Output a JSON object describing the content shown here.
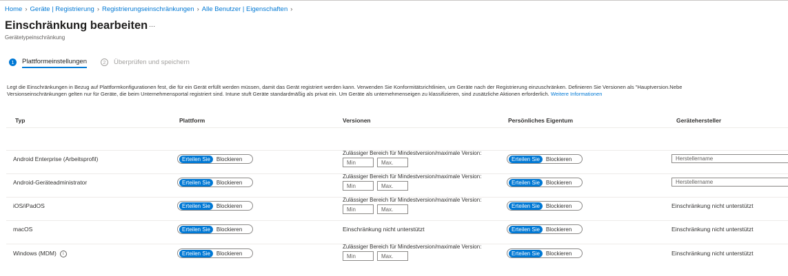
{
  "breadcrumb": [
    "Home",
    "Geräte | Registrierung",
    "Registrierungseinschränkungen",
    "Alle Benutzer | Eigenschaften"
  ],
  "header": {
    "title": "Einschränkung bearbeiten",
    "more": "...",
    "subtitle": "Gerätetypeinschränkung"
  },
  "steps": [
    {
      "num": "1",
      "label": "Plattformeinstellungen"
    },
    {
      "num": "2",
      "label": "Überprüfen und speichern"
    }
  ],
  "description": {
    "line1": "Legt die Einschränkungen in Bezug auf Plattformkonfigurationen fest, die für ein Gerät erfüllt werden müssen, damit das Gerät registriert werden kann. Verwenden Sie Konformitätsrichtlinien, um Geräte nach der Registrierung einzuschränken. Definieren Sie Versionen als \"Hauptversion.Nebe",
    "line2": "Versionseinschränkungen gelten nur für Geräte, die beim Unternehmensportal registriert sind. Intune stuft Geräte standardmäßig als privat ein. Um Geräte als unternehmenseigen zu klassifizieren, sind zusätzliche Aktionen erforderlich.",
    "link": "Weitere Informationen"
  },
  "table": {
    "headers": {
      "type": "Typ",
      "platform": "Plattform",
      "versions": "Versionen",
      "ownership": "Persönliches Eigentum",
      "manufacturer": "Gerätehersteller"
    },
    "toggle": {
      "allow": "Erteilen Sie",
      "block": "Blockieren"
    },
    "version_label": "Zulässiger Bereich für Mindestversion/maximale Version:",
    "min_placeholder": "Min",
    "max_placeholder": "Max.",
    "manufacturer_placeholder": "Herstellername",
    "not_supported": "Einschränkung nicht unterstützt",
    "rows": [
      {
        "type": "Android Enterprise (Arbeitsprofil)"
      },
      {
        "type": "Android-Geräteadministrator"
      },
      {
        "type": "iOS/iPadOS"
      },
      {
        "type": "macOS"
      },
      {
        "type": "Windows (MDM)",
        "info_icon": "info-icon"
      }
    ]
  },
  "colors": {
    "accent": "#0078d4",
    "text": "#323130",
    "muted": "#a19f9d"
  }
}
